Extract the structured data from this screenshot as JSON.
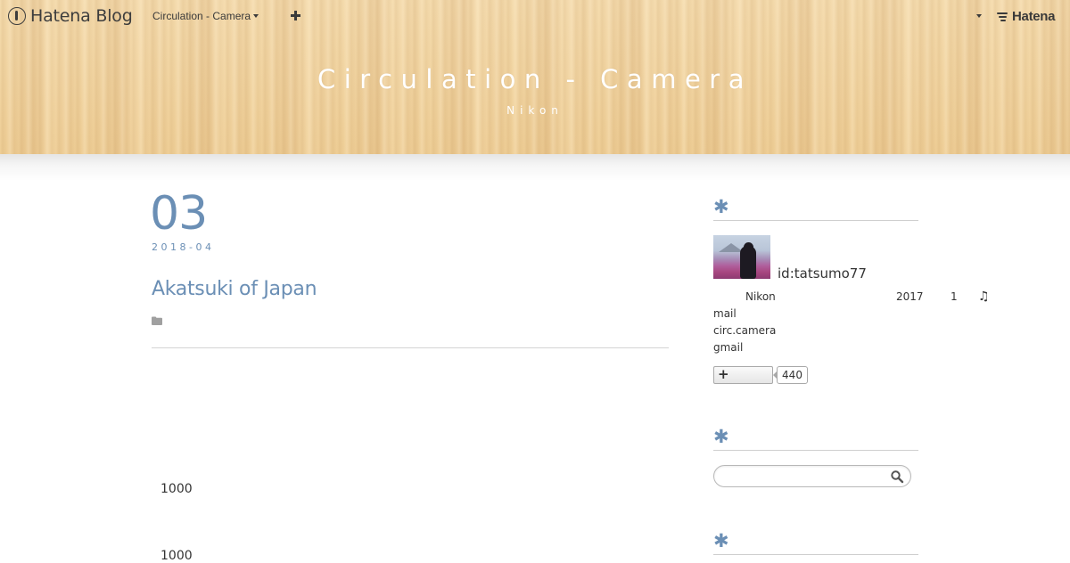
{
  "globalbar": {
    "brand": "Hatena Blog",
    "blog_select": "Circulation - Camera",
    "plus": "+",
    "hatena": "Hatena"
  },
  "blog": {
    "title": "Circulation - Camera",
    "description": "Nikon"
  },
  "entry": {
    "day": "03",
    "year_month": "2018-04",
    "title": "Akatsuki of Japan",
    "body_lines": [
      "1000",
      "1000"
    ]
  },
  "sidebar": {
    "profile": {
      "user_id": "id:tatsumo77",
      "camera": "Nikon",
      "year": "2017",
      "number": "1",
      "music_icon": "music-note-icon",
      "contact_lines": [
        "mail",
        "circ.camera",
        "gmail"
      ],
      "reader_button": "+",
      "reader_count": "440"
    },
    "search": {
      "placeholder": "",
      "value": ""
    }
  },
  "colors": {
    "accent": "#6b8fb5",
    "header_wood": "#f2d6a4",
    "divider": "#d5d5d5"
  }
}
